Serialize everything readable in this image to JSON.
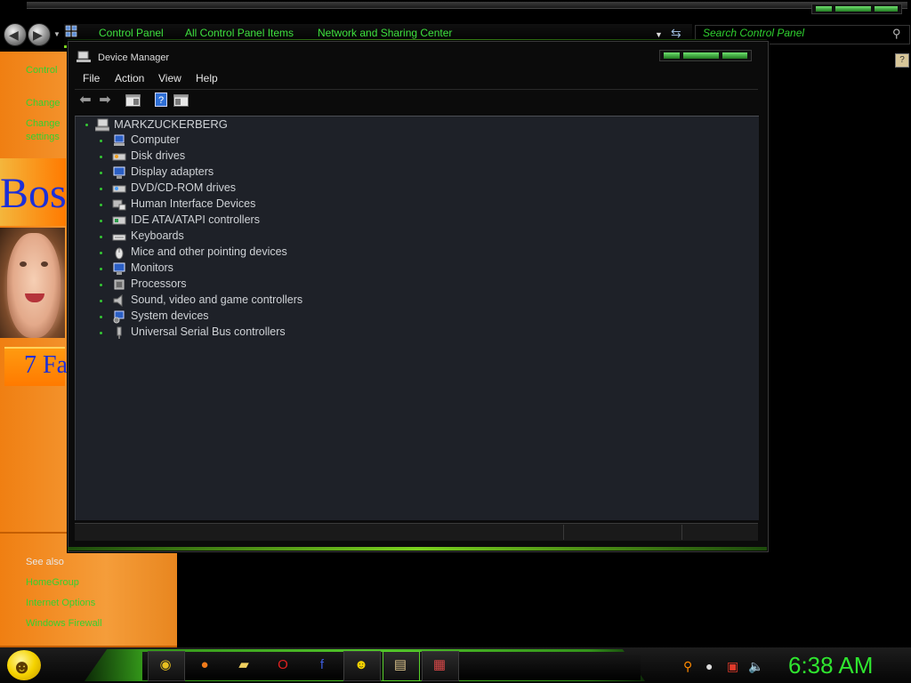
{
  "explorer": {
    "breadcrumbs": [
      "Control Panel",
      "All Control Panel Items",
      "Network and Sharing Center"
    ],
    "search_placeholder": "Search Control Panel"
  },
  "left_pane": {
    "links": [
      "Control",
      "Change",
      "Change",
      "settings"
    ],
    "see_also_title": "See also",
    "see_also_links": [
      "HomeGroup",
      "Internet Options",
      "Windows Firewall"
    ]
  },
  "ad": {
    "headline": "Boss",
    "subtitle": "7 Fa"
  },
  "device_manager": {
    "title": "Device Manager",
    "menu": [
      "File",
      "Action",
      "View",
      "Help"
    ],
    "root": "MARKZUCKERBERG",
    "devices": [
      {
        "label": "Computer",
        "icon": "computer-icon"
      },
      {
        "label": "Disk drives",
        "icon": "disk-drive-icon"
      },
      {
        "label": "Display adapters",
        "icon": "display-adapter-icon"
      },
      {
        "label": "DVD/CD-ROM drives",
        "icon": "dvd-drive-icon"
      },
      {
        "label": "Human Interface Devices",
        "icon": "hid-icon"
      },
      {
        "label": "IDE ATA/ATAPI controllers",
        "icon": "ide-controller-icon"
      },
      {
        "label": "Keyboards",
        "icon": "keyboard-icon"
      },
      {
        "label": "Mice and other pointing devices",
        "icon": "mouse-icon"
      },
      {
        "label": "Monitors",
        "icon": "monitor-icon"
      },
      {
        "label": "Processors",
        "icon": "processor-icon"
      },
      {
        "label": "Sound, video and game controllers",
        "icon": "sound-icon"
      },
      {
        "label": "System devices",
        "icon": "system-devices-icon"
      },
      {
        "label": "Universal Serial Bus controllers",
        "icon": "usb-icon"
      }
    ]
  },
  "taskbar": {
    "pinned": [
      "chrome-icon",
      "firefox-icon",
      "folder-icon",
      "opera-icon",
      "facebook-icon",
      "messenger-icon",
      "device-manager-task-icon",
      "app-task-icon"
    ],
    "clock": "6:38 AM"
  },
  "colors": {
    "accent_green": "#3ee13e",
    "pane_orange": "#f07f12",
    "window_dark": "#1e2128"
  }
}
